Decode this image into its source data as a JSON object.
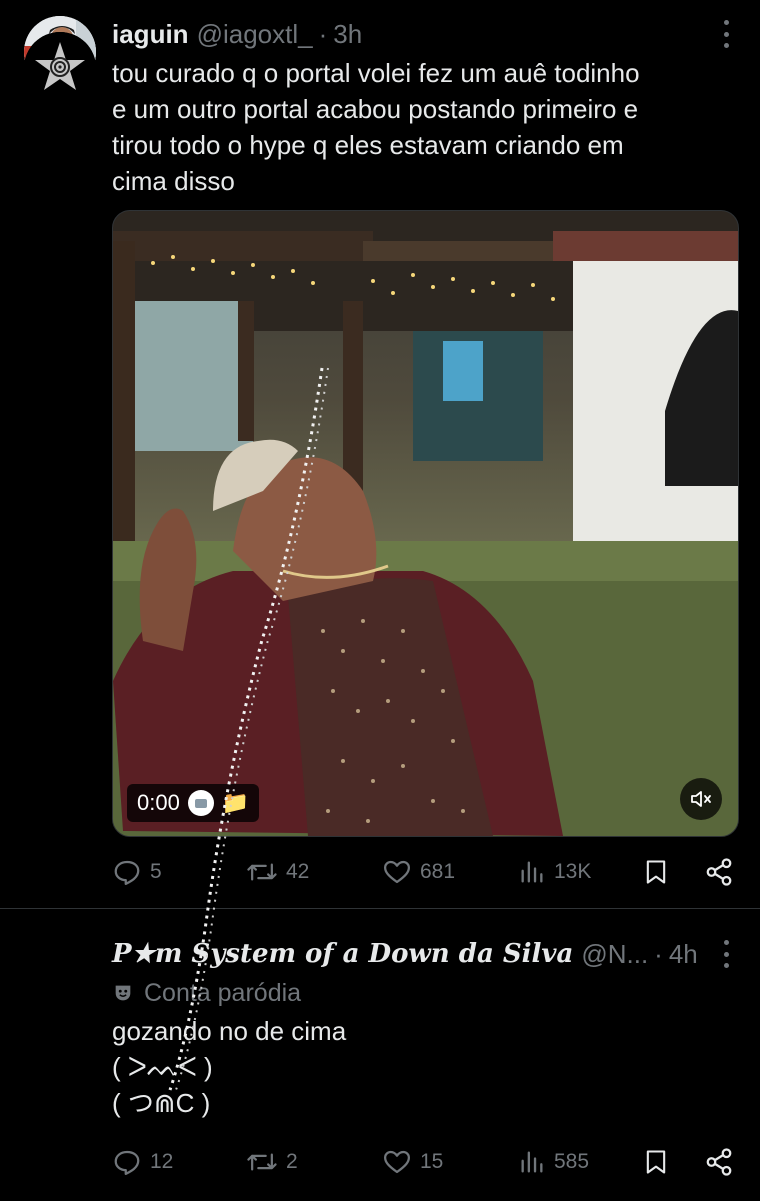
{
  "tweet1": {
    "author": {
      "name": "iaguin",
      "handle": "@iagoxtl_",
      "time": "3h"
    },
    "text": "tou curado q o portal volei fez um auê todinho\ne um outro portal acabou postando primeiro e\ntirou todo o hype q eles estavam criando em\ncima disso",
    "video": {
      "timecode": "0:00",
      "emoji": "📁"
    },
    "stats": {
      "replies": "5",
      "reposts": "42",
      "likes": "681",
      "views": "13K"
    }
  },
  "tweet2": {
    "author": {
      "name": "P★m System of a Down da Silva",
      "handle": "@N...",
      "time": "4h"
    },
    "label": "Conta paródia",
    "text": "gozando no de cima\n( ᐳᨓᐸ )\n( つ⋒C )",
    "stats": {
      "replies": "12",
      "reposts": "2",
      "likes": "15",
      "views": "585"
    }
  },
  "colors": {
    "background": "#000000",
    "text": "#e7e9ea",
    "muted": "#71767b",
    "border": "#2f3336"
  }
}
